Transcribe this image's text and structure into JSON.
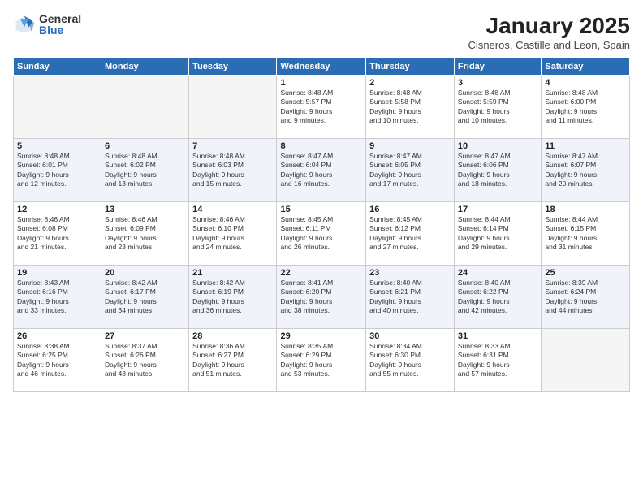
{
  "logo": {
    "general": "General",
    "blue": "Blue"
  },
  "title": "January 2025",
  "subtitle": "Cisneros, Castille and Leon, Spain",
  "weekdays": [
    "Sunday",
    "Monday",
    "Tuesday",
    "Wednesday",
    "Thursday",
    "Friday",
    "Saturday"
  ],
  "weeks": [
    [
      {
        "day": "",
        "info": ""
      },
      {
        "day": "",
        "info": ""
      },
      {
        "day": "",
        "info": ""
      },
      {
        "day": "1",
        "info": "Sunrise: 8:48 AM\nSunset: 5:57 PM\nDaylight: 9 hours\nand 9 minutes."
      },
      {
        "day": "2",
        "info": "Sunrise: 8:48 AM\nSunset: 5:58 PM\nDaylight: 9 hours\nand 10 minutes."
      },
      {
        "day": "3",
        "info": "Sunrise: 8:48 AM\nSunset: 5:59 PM\nDaylight: 9 hours\nand 10 minutes."
      },
      {
        "day": "4",
        "info": "Sunrise: 8:48 AM\nSunset: 6:00 PM\nDaylight: 9 hours\nand 11 minutes."
      }
    ],
    [
      {
        "day": "5",
        "info": "Sunrise: 8:48 AM\nSunset: 6:01 PM\nDaylight: 9 hours\nand 12 minutes."
      },
      {
        "day": "6",
        "info": "Sunrise: 8:48 AM\nSunset: 6:02 PM\nDaylight: 9 hours\nand 13 minutes."
      },
      {
        "day": "7",
        "info": "Sunrise: 8:48 AM\nSunset: 6:03 PM\nDaylight: 9 hours\nand 15 minutes."
      },
      {
        "day": "8",
        "info": "Sunrise: 8:47 AM\nSunset: 6:04 PM\nDaylight: 9 hours\nand 16 minutes."
      },
      {
        "day": "9",
        "info": "Sunrise: 8:47 AM\nSunset: 6:05 PM\nDaylight: 9 hours\nand 17 minutes."
      },
      {
        "day": "10",
        "info": "Sunrise: 8:47 AM\nSunset: 6:06 PM\nDaylight: 9 hours\nand 18 minutes."
      },
      {
        "day": "11",
        "info": "Sunrise: 8:47 AM\nSunset: 6:07 PM\nDaylight: 9 hours\nand 20 minutes."
      }
    ],
    [
      {
        "day": "12",
        "info": "Sunrise: 8:46 AM\nSunset: 6:08 PM\nDaylight: 9 hours\nand 21 minutes."
      },
      {
        "day": "13",
        "info": "Sunrise: 8:46 AM\nSunset: 6:09 PM\nDaylight: 9 hours\nand 23 minutes."
      },
      {
        "day": "14",
        "info": "Sunrise: 8:46 AM\nSunset: 6:10 PM\nDaylight: 9 hours\nand 24 minutes."
      },
      {
        "day": "15",
        "info": "Sunrise: 8:45 AM\nSunset: 6:11 PM\nDaylight: 9 hours\nand 26 minutes."
      },
      {
        "day": "16",
        "info": "Sunrise: 8:45 AM\nSunset: 6:12 PM\nDaylight: 9 hours\nand 27 minutes."
      },
      {
        "day": "17",
        "info": "Sunrise: 8:44 AM\nSunset: 6:14 PM\nDaylight: 9 hours\nand 29 minutes."
      },
      {
        "day": "18",
        "info": "Sunrise: 8:44 AM\nSunset: 6:15 PM\nDaylight: 9 hours\nand 31 minutes."
      }
    ],
    [
      {
        "day": "19",
        "info": "Sunrise: 8:43 AM\nSunset: 6:16 PM\nDaylight: 9 hours\nand 33 minutes."
      },
      {
        "day": "20",
        "info": "Sunrise: 8:42 AM\nSunset: 6:17 PM\nDaylight: 9 hours\nand 34 minutes."
      },
      {
        "day": "21",
        "info": "Sunrise: 8:42 AM\nSunset: 6:19 PM\nDaylight: 9 hours\nand 36 minutes."
      },
      {
        "day": "22",
        "info": "Sunrise: 8:41 AM\nSunset: 6:20 PM\nDaylight: 9 hours\nand 38 minutes."
      },
      {
        "day": "23",
        "info": "Sunrise: 8:40 AM\nSunset: 6:21 PM\nDaylight: 9 hours\nand 40 minutes."
      },
      {
        "day": "24",
        "info": "Sunrise: 8:40 AM\nSunset: 6:22 PM\nDaylight: 9 hours\nand 42 minutes."
      },
      {
        "day": "25",
        "info": "Sunrise: 8:39 AM\nSunset: 6:24 PM\nDaylight: 9 hours\nand 44 minutes."
      }
    ],
    [
      {
        "day": "26",
        "info": "Sunrise: 8:38 AM\nSunset: 6:25 PM\nDaylight: 9 hours\nand 46 minutes."
      },
      {
        "day": "27",
        "info": "Sunrise: 8:37 AM\nSunset: 6:26 PM\nDaylight: 9 hours\nand 48 minutes."
      },
      {
        "day": "28",
        "info": "Sunrise: 8:36 AM\nSunset: 6:27 PM\nDaylight: 9 hours\nand 51 minutes."
      },
      {
        "day": "29",
        "info": "Sunrise: 8:35 AM\nSunset: 6:29 PM\nDaylight: 9 hours\nand 53 minutes."
      },
      {
        "day": "30",
        "info": "Sunrise: 8:34 AM\nSunset: 6:30 PM\nDaylight: 9 hours\nand 55 minutes."
      },
      {
        "day": "31",
        "info": "Sunrise: 8:33 AM\nSunset: 6:31 PM\nDaylight: 9 hours\nand 57 minutes."
      },
      {
        "day": "",
        "info": ""
      }
    ]
  ]
}
